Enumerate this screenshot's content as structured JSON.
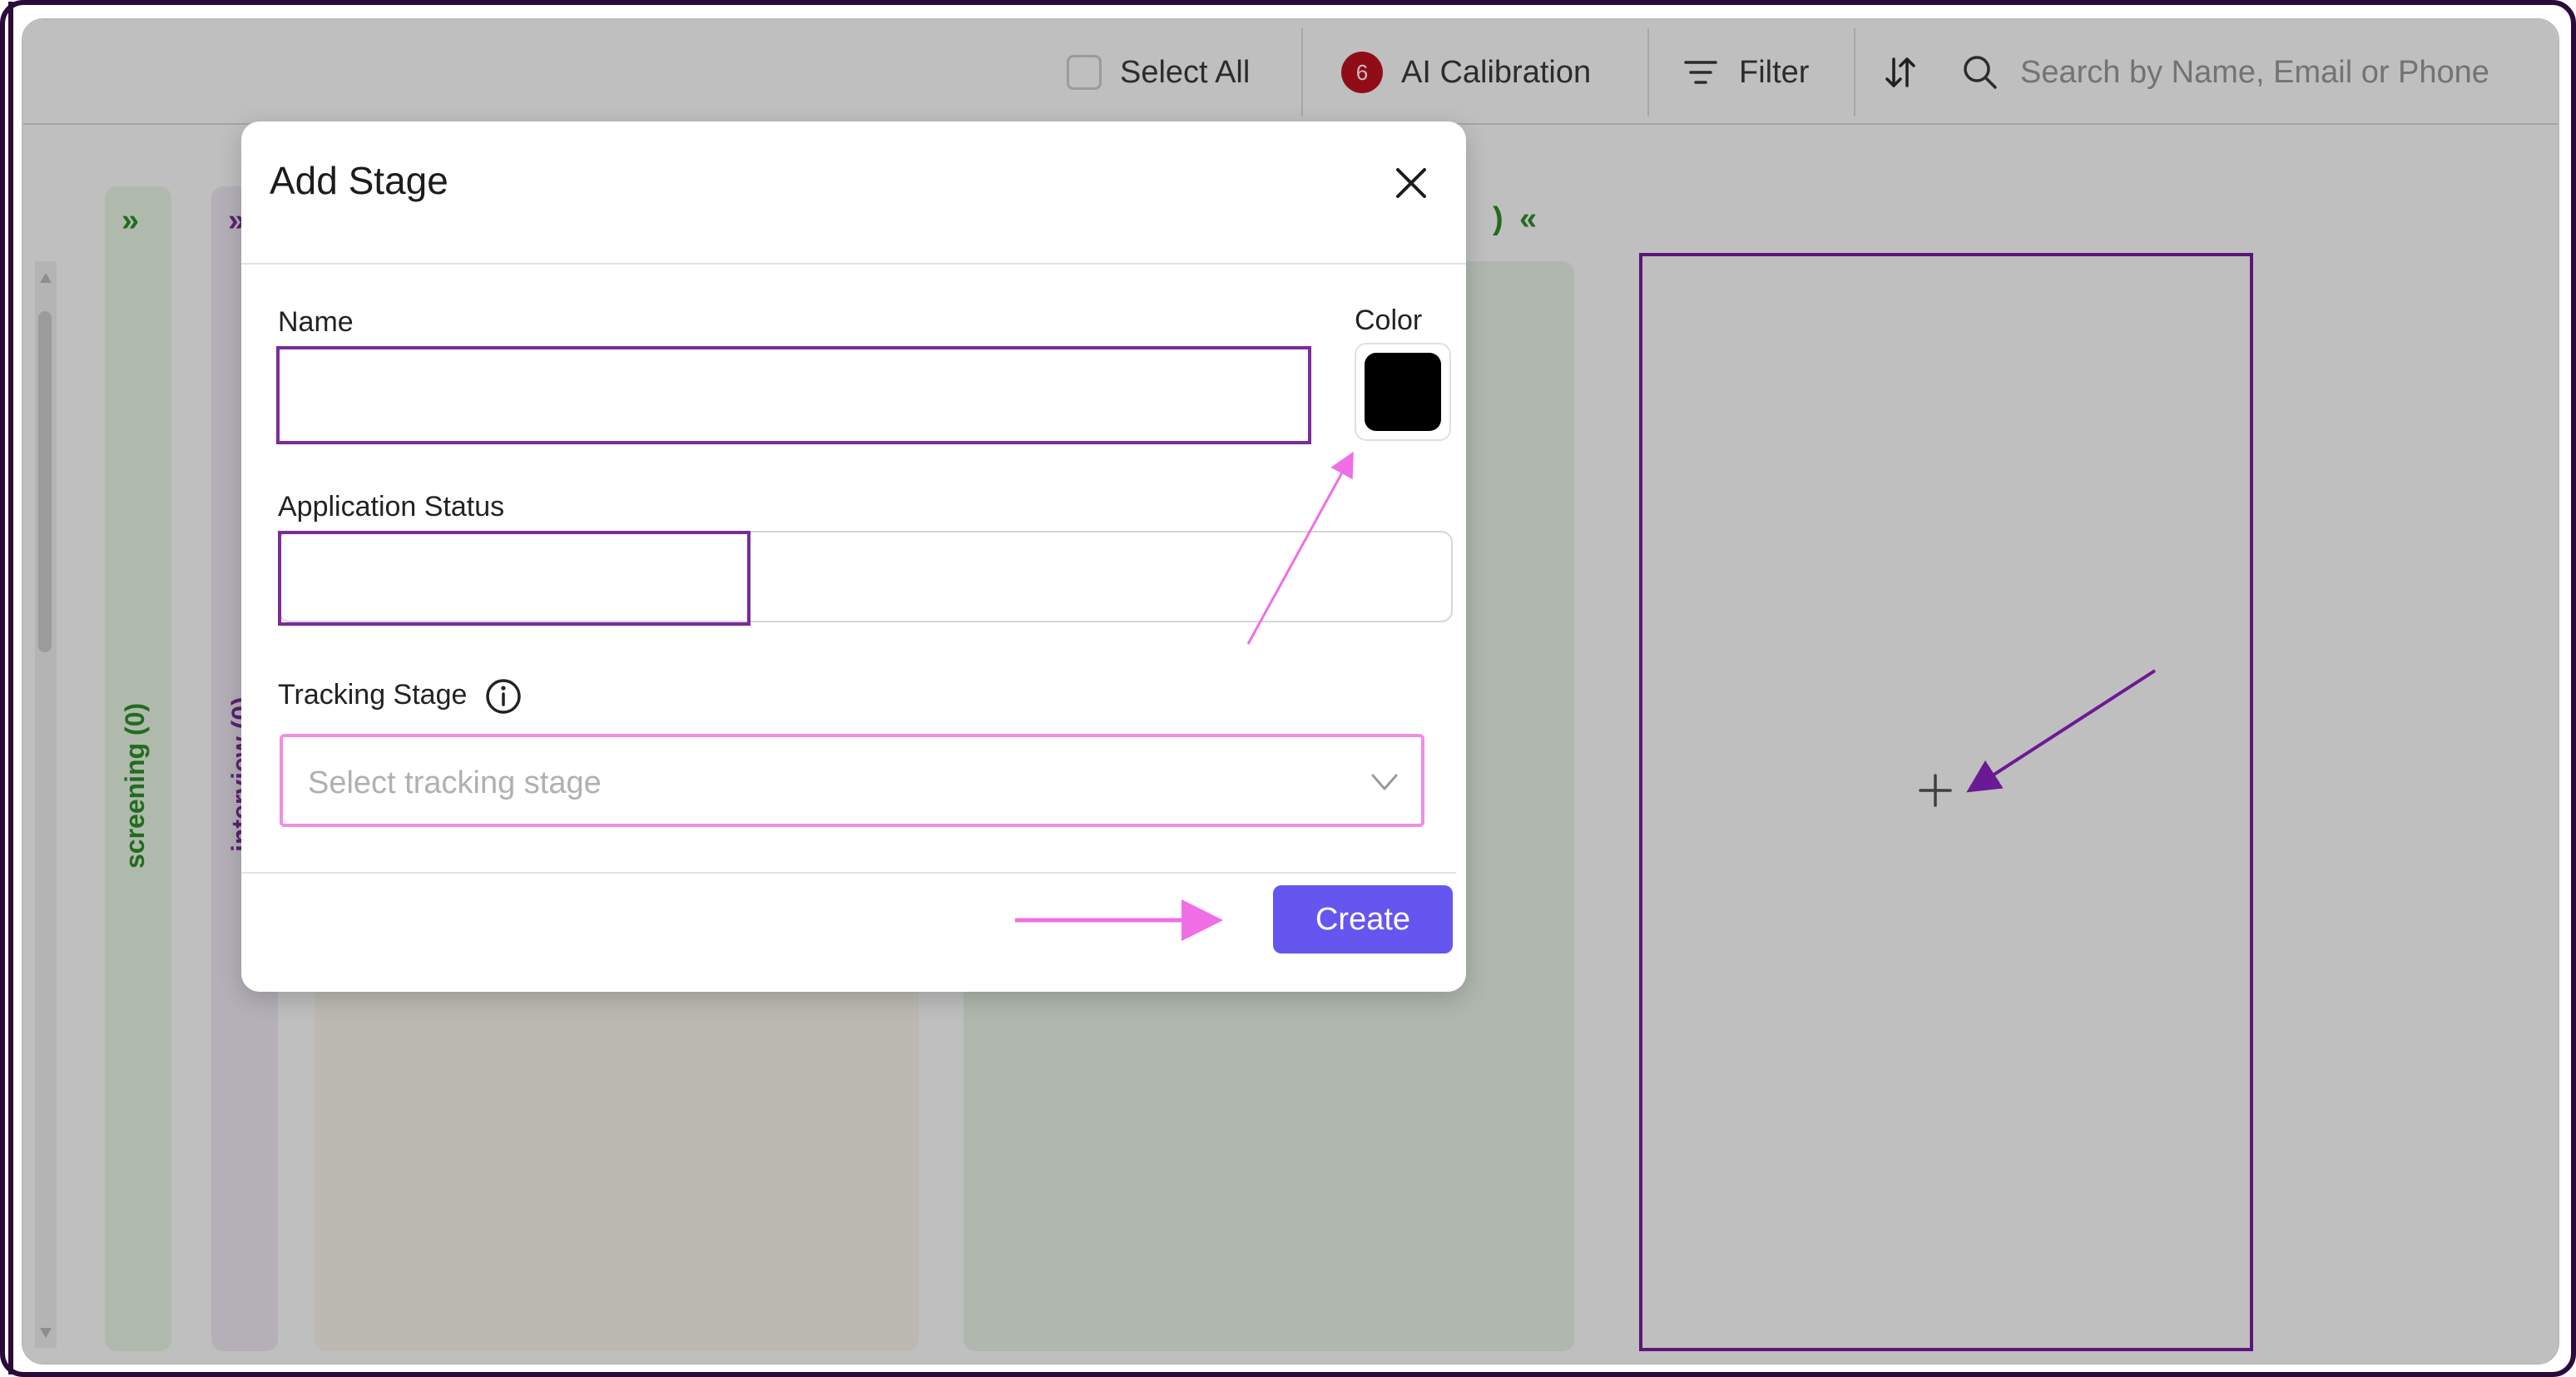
{
  "toolbar": {
    "select_all_label": "Select All",
    "ai_calibration_count": "6",
    "ai_calibration_label": "AI Calibration",
    "filter_label": "Filter",
    "search_placeholder": "Search by Name, Email or Phone"
  },
  "board": {
    "columns": [
      {
        "label": "screening (0)",
        "color": "#2e8f2a",
        "collapsed": true
      },
      {
        "label": "interview (0)",
        "color": "#7a2c99",
        "collapsed": true
      },
      {
        "label": "",
        "collapsed": false
      },
      {
        "label": "",
        "collapsed": false
      }
    ],
    "add_column_icon": "plus-icon"
  },
  "modal": {
    "title": "Add Stage",
    "close_icon": "close-icon",
    "name_label": "Name",
    "name_value": "",
    "color_label": "Color",
    "color_value": "#000000",
    "status_label": "Application Status",
    "status_value": "",
    "tracking_label": "Tracking Stage",
    "tracking_info_icon": "info-icon",
    "tracking_placeholder": "Select tracking stage",
    "create_label": "Create"
  },
  "colors": {
    "accent": "#6556f0",
    "highlight_purple": "#7a2c99",
    "highlight_pink": "#f08ee7",
    "badge_red": "#c1121f"
  }
}
